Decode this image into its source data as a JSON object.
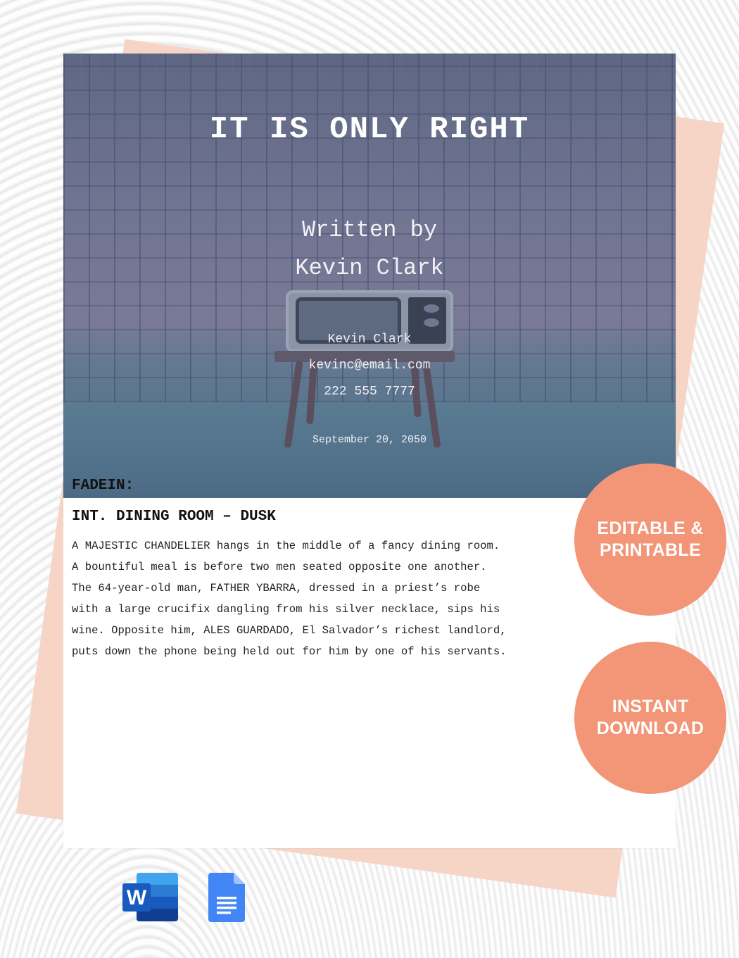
{
  "document": {
    "title": "IT IS ONLY RIGHT",
    "written_by_label": "Written by",
    "author": "Kevin Clark",
    "contact": {
      "name": "Kevin Clark",
      "email": "kevinc@email.com",
      "phone": "222 555 7777"
    },
    "date": "September 20, 2050",
    "script": {
      "transition": "FADEIN:",
      "scene_heading": "INT. DINING ROOM – DUSK",
      "action_lines": [
        "A MAJESTIC CHANDELIER hangs in the middle of a fancy dining room.",
        "A bountiful meal is before two men seated opposite one another.",
        "The 64-year-old man, FATHER YBARRA, dressed in a priest’s robe",
        "with a large crucifix dangling from his silver necklace, sips his",
        "wine. Opposite him, ALES GUARDADO, El Salvador’s richest landlord,",
        "puts down the phone being held out for him by one of his servants."
      ]
    }
  },
  "badges": [
    {
      "line1": "EDITABLE &",
      "line2": "PRINTABLE"
    },
    {
      "line1": "INSTANT",
      "line2": "DOWNLOAD"
    }
  ],
  "app_icons": [
    {
      "name": "Microsoft Word",
      "icon": "word-icon",
      "letter": "W"
    },
    {
      "name": "Google Docs",
      "icon": "google-docs-icon"
    }
  ],
  "colors": {
    "badge": "#f39577",
    "back_sheet": "#f6d5c6",
    "hero_tint": "#6f7592",
    "word_blue": "#185abd",
    "docs_blue": "#4285f4"
  }
}
